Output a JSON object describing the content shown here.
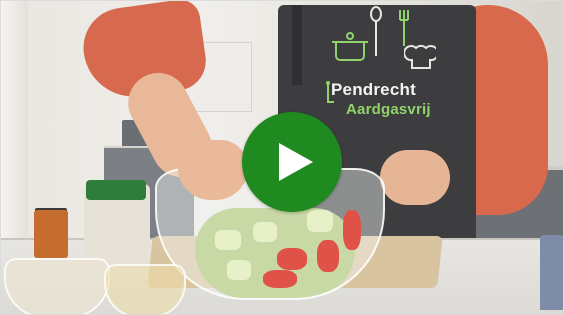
{
  "video": {
    "apron_line1": "Pendrecht",
    "apron_line2": "Aardgasvrij",
    "play_button_color": "#1f8a1f",
    "play_icon": "play-icon"
  },
  "colors": {
    "sweater": "#d76a4e",
    "apron": "#3d3d3f",
    "apron_accent": "#8fd36a"
  }
}
